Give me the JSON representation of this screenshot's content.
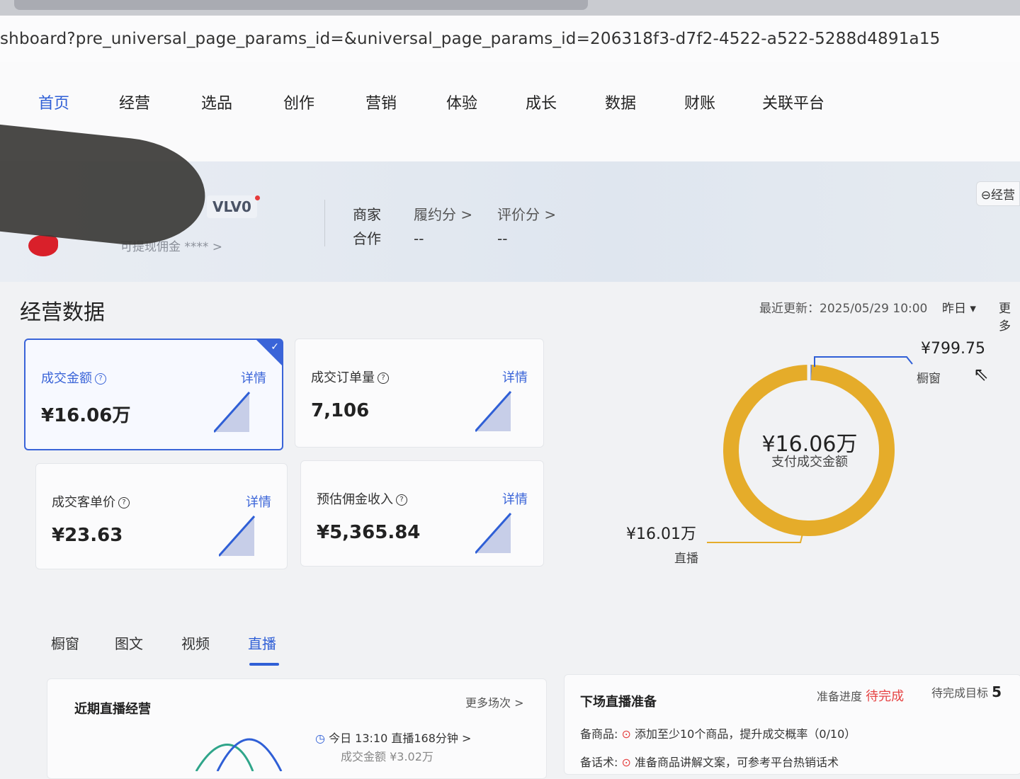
{
  "browser": {
    "url": "shboard?pre_universal_page_params_id=&universal_page_params_id=206318f3-d7f2-4522-a522-5288d4891a15"
  },
  "nav": {
    "items": [
      "首页",
      "经营",
      "选品",
      "创作",
      "营销",
      "体验",
      "成长",
      "数据",
      "财账",
      "关联平台"
    ],
    "active": "首页"
  },
  "shop": {
    "level": "LV0",
    "commission_label": "可提现佣金 ****",
    "merchant_cooperation_label": "商家合作",
    "merchant_line1": "商家",
    "merchant_line2": "合作",
    "fulfillment_label": "履约分 >",
    "fulfillment_value": "--",
    "rating_label": "评价分 >",
    "rating_value": "--",
    "manage_button": "经营"
  },
  "overview": {
    "title": "经营数据",
    "last_update": "最近更新：2025/05/29 10:00",
    "period": "昨日 ▾",
    "more": "更多",
    "cards": [
      {
        "title": "成交金额",
        "value": "¥16.06万",
        "detail": "详情",
        "selected": true
      },
      {
        "title": "成交订单量",
        "value": "7,106",
        "detail": "详情",
        "selected": false
      },
      {
        "title": "成交客单价",
        "value": "¥23.63",
        "detail": "详情",
        "selected": false
      },
      {
        "title": "预估佣金收入",
        "value": "¥5,365.84",
        "detail": "详情",
        "selected": false
      }
    ]
  },
  "donut": {
    "center_value": "¥16.06万",
    "center_label": "支付成交金额",
    "segments": [
      {
        "name": "橱窗",
        "value": "¥799.75",
        "amount": 799.75,
        "color": "#2f5fd6"
      },
      {
        "name": "直播",
        "value": "¥16.01万",
        "amount": 160100,
        "color": "#e5ac2a"
      }
    ]
  },
  "lower_tabs": {
    "items": [
      "橱窗",
      "图文",
      "视频",
      "直播"
    ],
    "active": "直播"
  },
  "live_panel": {
    "title": "近期直播经营",
    "more": "更多场次 >",
    "session_time": "今日 13:10 直播168分钟 >",
    "session_amount": "成交金额 ¥3.02万"
  },
  "prep_panel": {
    "title": "下场直播准备",
    "progress_label": "准备进度",
    "progress_status": "待完成",
    "pending_label": "待完成目标",
    "pending_count": "5",
    "goods_label": "备商品:",
    "goods_task": "添加至少10个商品，提升成交概率（0/10）",
    "script_label": "备话术:",
    "script_task": "准备商品讲解文案，可参考平台热销话术"
  }
}
